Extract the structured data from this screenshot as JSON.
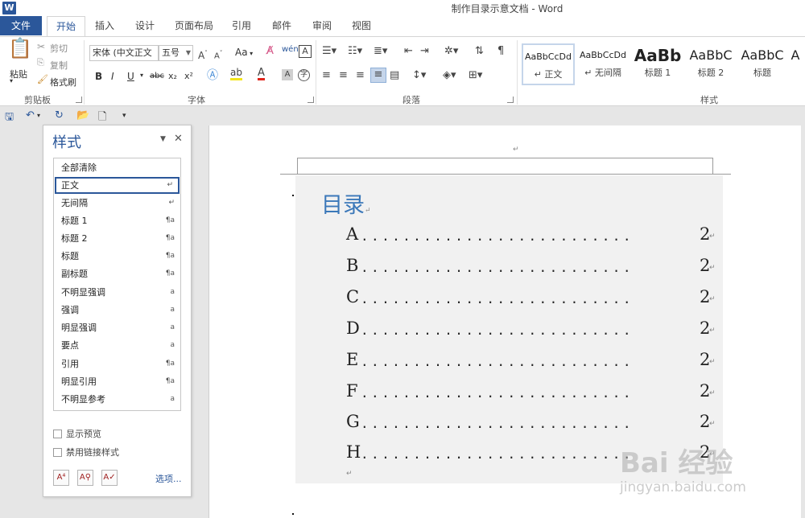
{
  "app": {
    "logo": "W",
    "title": "制作目录示意文档 - Word"
  },
  "tabs": [
    "文件",
    "开始",
    "插入",
    "设计",
    "页面布局",
    "引用",
    "邮件",
    "审阅",
    "视图"
  ],
  "ribbon": {
    "clipboard": {
      "paste": "粘贴",
      "cut": "剪切",
      "copy": "复制",
      "format_painter": "格式刷",
      "label": "剪贴板"
    },
    "font": {
      "font_name": "宋体 (中文正文",
      "font_size": "五号",
      "change_case": "Aa",
      "bold": "B",
      "italic": "I",
      "underline": "U",
      "strike": "abc",
      "subscript": "x₂",
      "superscript": "x²",
      "label": "字体"
    },
    "paragraph": {
      "label": "段落"
    },
    "styles": {
      "label": "样式",
      "items": [
        {
          "preview": "AaBbCcDd",
          "name": "↵ 正文"
        },
        {
          "preview": "AaBbCcDd",
          "name": "↵ 无间隔"
        },
        {
          "preview": "AaBb",
          "name": "标题 1"
        },
        {
          "preview": "AaBbC",
          "name": "标题 2"
        },
        {
          "preview": "AaBbC",
          "name": "标题"
        },
        {
          "preview": "A",
          "name": ""
        }
      ]
    }
  },
  "styles_pane": {
    "title": "样式",
    "items": [
      {
        "label": "全部清除",
        "mark": ""
      },
      {
        "label": "正文",
        "mark": "↵"
      },
      {
        "label": "无间隔",
        "mark": "↵"
      },
      {
        "label": "标题 1",
        "mark": "¶a"
      },
      {
        "label": "标题 2",
        "mark": "¶a"
      },
      {
        "label": "标题",
        "mark": "¶a"
      },
      {
        "label": "副标题",
        "mark": "¶a"
      },
      {
        "label": "不明显强调",
        "mark": "a"
      },
      {
        "label": "强调",
        "mark": "a"
      },
      {
        "label": "明显强调",
        "mark": "a"
      },
      {
        "label": "要点",
        "mark": "a"
      },
      {
        "label": "引用",
        "mark": "¶a"
      },
      {
        "label": "明显引用",
        "mark": "¶a"
      },
      {
        "label": "不明显参考",
        "mark": "a"
      }
    ],
    "show_preview": "显示预览",
    "disable_linked": "禁用链接样式",
    "options": "选项..."
  },
  "document": {
    "toc_title": "目录",
    "entries": [
      {
        "label": "A",
        "page": "2"
      },
      {
        "label": "B",
        "page": "2"
      },
      {
        "label": "C",
        "page": "2"
      },
      {
        "label": "D",
        "page": "2"
      },
      {
        "label": "E",
        "page": "2"
      },
      {
        "label": "F",
        "page": "2"
      },
      {
        "label": "G",
        "page": "2"
      },
      {
        "label": "H",
        "page": "2"
      }
    ],
    "dots": "..........................",
    "return_mark": "↵"
  },
  "watermark": {
    "main": "Bai 经验",
    "sub": "jingyan.baidu.com"
  }
}
